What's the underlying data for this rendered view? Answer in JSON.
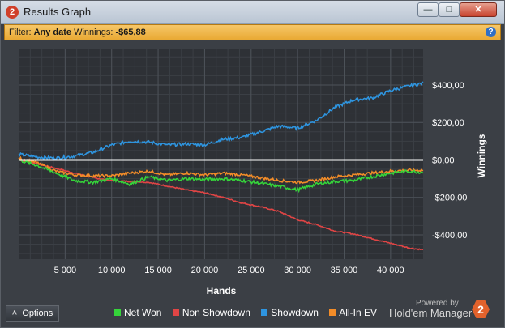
{
  "window": {
    "title": "Results Graph",
    "app_badge": "2",
    "controls": {
      "minimize": "—",
      "maximize": "□",
      "close": "✕"
    }
  },
  "filter_bar": {
    "prefix": "Filter: ",
    "date_label": "Any date",
    "winnings_label": " Winnings: ",
    "winnings_value": "-$65,88",
    "help_icon": "?"
  },
  "footer": {
    "options_label": "Options",
    "options_icon": "˄",
    "powered_by": "Powered by",
    "brand": "Hold'em Manager",
    "brand_badge": "2"
  },
  "colors": {
    "net_won": "#35d43a",
    "non_showdown": "#e04545",
    "showdown": "#2e95e0",
    "all_in_ev": "#f28c28",
    "zero_line": "#ffffff",
    "plot_bg": "#2e3136"
  },
  "chart_data": {
    "type": "line",
    "xlabel": "Hands",
    "ylabel": "Winnings",
    "xlim": [
      0,
      43500
    ],
    "ylim": [
      -530,
      590
    ],
    "x_ticks": [
      "5 000",
      "10 000",
      "15 000",
      "20 000",
      "25 000",
      "30 000",
      "35 000",
      "40 000"
    ],
    "x_tick_values": [
      5000,
      10000,
      15000,
      20000,
      25000,
      30000,
      35000,
      40000
    ],
    "y_ticks": [
      "$400,00",
      "$200,00",
      "$0,00",
      "-$200,00",
      "-$400,00"
    ],
    "y_tick_values": [
      400,
      200,
      0,
      -200,
      -400
    ],
    "grid": true,
    "legend_position": "bottom",
    "x": [
      0,
      2000,
      4000,
      6000,
      8000,
      10000,
      12000,
      14000,
      16000,
      18000,
      20000,
      22000,
      24000,
      26000,
      28000,
      30000,
      32000,
      34000,
      36000,
      38000,
      40000,
      42000,
      43500
    ],
    "series": [
      {
        "name": "Net Won",
        "values": [
          0,
          -30,
          -70,
          -110,
          -120,
          -100,
          -130,
          -90,
          -110,
          -100,
          -105,
          -100,
          -110,
          -125,
          -140,
          -160,
          -130,
          -115,
          -110,
          -90,
          -70,
          -60,
          -66
        ]
      },
      {
        "name": "Non Showdown",
        "values": [
          0,
          -20,
          -45,
          -70,
          -95,
          -110,
          -115,
          -120,
          -140,
          -160,
          -175,
          -200,
          -230,
          -250,
          -275,
          -320,
          -345,
          -380,
          -395,
          -420,
          -445,
          -470,
          -480
        ]
      },
      {
        "name": "Showdown",
        "values": [
          30,
          15,
          10,
          20,
          40,
          80,
          100,
          95,
          80,
          85,
          80,
          110,
          120,
          150,
          180,
          170,
          210,
          280,
          320,
          330,
          370,
          395,
          410
        ]
      },
      {
        "name": "All-In EV",
        "values": [
          10,
          -15,
          -60,
          -80,
          -85,
          -85,
          -70,
          -60,
          -80,
          -70,
          -80,
          -70,
          -80,
          -95,
          -110,
          -120,
          -110,
          -90,
          -80,
          -70,
          -60,
          -55,
          -55
        ]
      }
    ]
  }
}
